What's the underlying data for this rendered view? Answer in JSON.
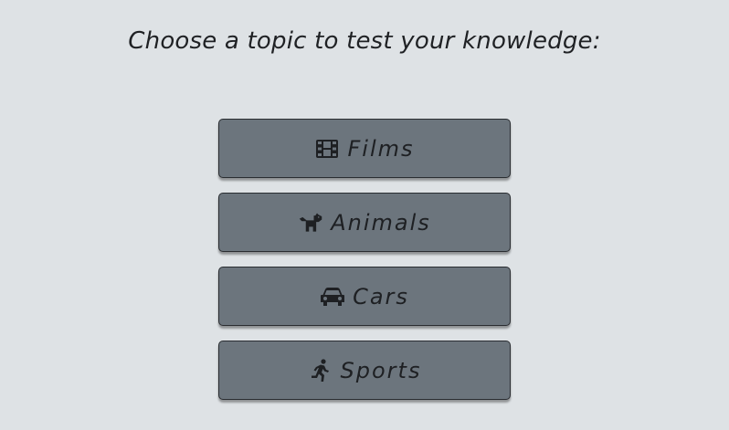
{
  "prompt": "Choose a topic to test your knowledge:",
  "topics": [
    {
      "label": "Films",
      "icon": "film-icon"
    },
    {
      "label": "Animals",
      "icon": "dog-icon"
    },
    {
      "label": "Cars",
      "icon": "car-icon"
    },
    {
      "label": "Sports",
      "icon": "running-person-icon"
    }
  ],
  "colors": {
    "background": "#dee2e5",
    "button": "#6c757d",
    "text": "#1e2023"
  }
}
